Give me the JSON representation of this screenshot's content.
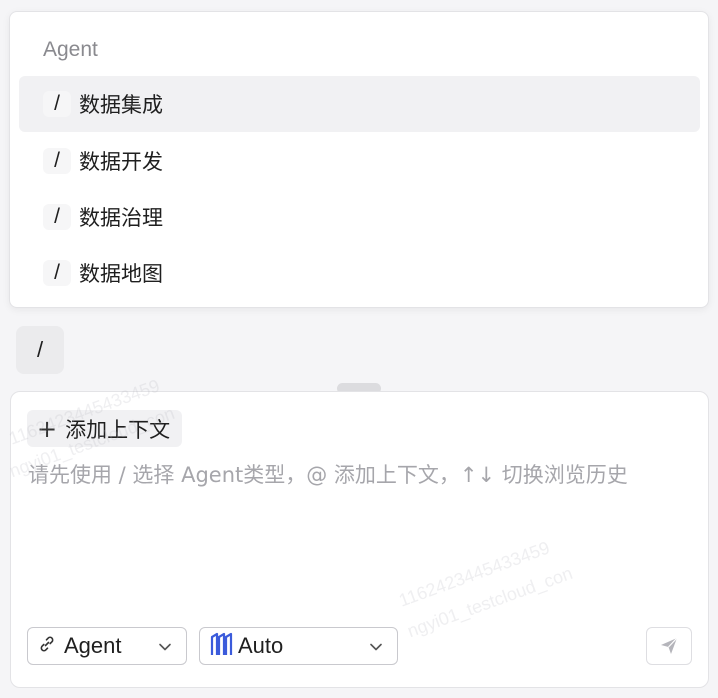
{
  "agent_menu": {
    "header": "Agent",
    "items": [
      {
        "slash": "/",
        "label": "数据集成",
        "active": true
      },
      {
        "slash": "/",
        "label": "数据开发",
        "active": false
      },
      {
        "slash": "/",
        "label": "数据治理",
        "active": false
      },
      {
        "slash": "/",
        "label": "数据地图",
        "active": false
      }
    ]
  },
  "slash_chip": "/",
  "composer": {
    "add_context_label": "添加上下文",
    "placeholder": "请先使用 / 选择 Agent类型，@ 添加上下文，↑↓ 切换浏览历史",
    "agent_select": {
      "label": "Agent",
      "icon": "link-icon"
    },
    "model_select": {
      "label": "Auto",
      "icon": "model-logo-icon",
      "icon_color": "#3b5bdb"
    },
    "send_icon": "send-icon"
  },
  "watermark": {
    "line1": "1162423445433459",
    "line2": "ngyi01_testcloud_con"
  },
  "colors": {
    "active_row": "#f1f1f3",
    "placeholder": "#a6a6ab",
    "accent": "#3b5bdb"
  }
}
